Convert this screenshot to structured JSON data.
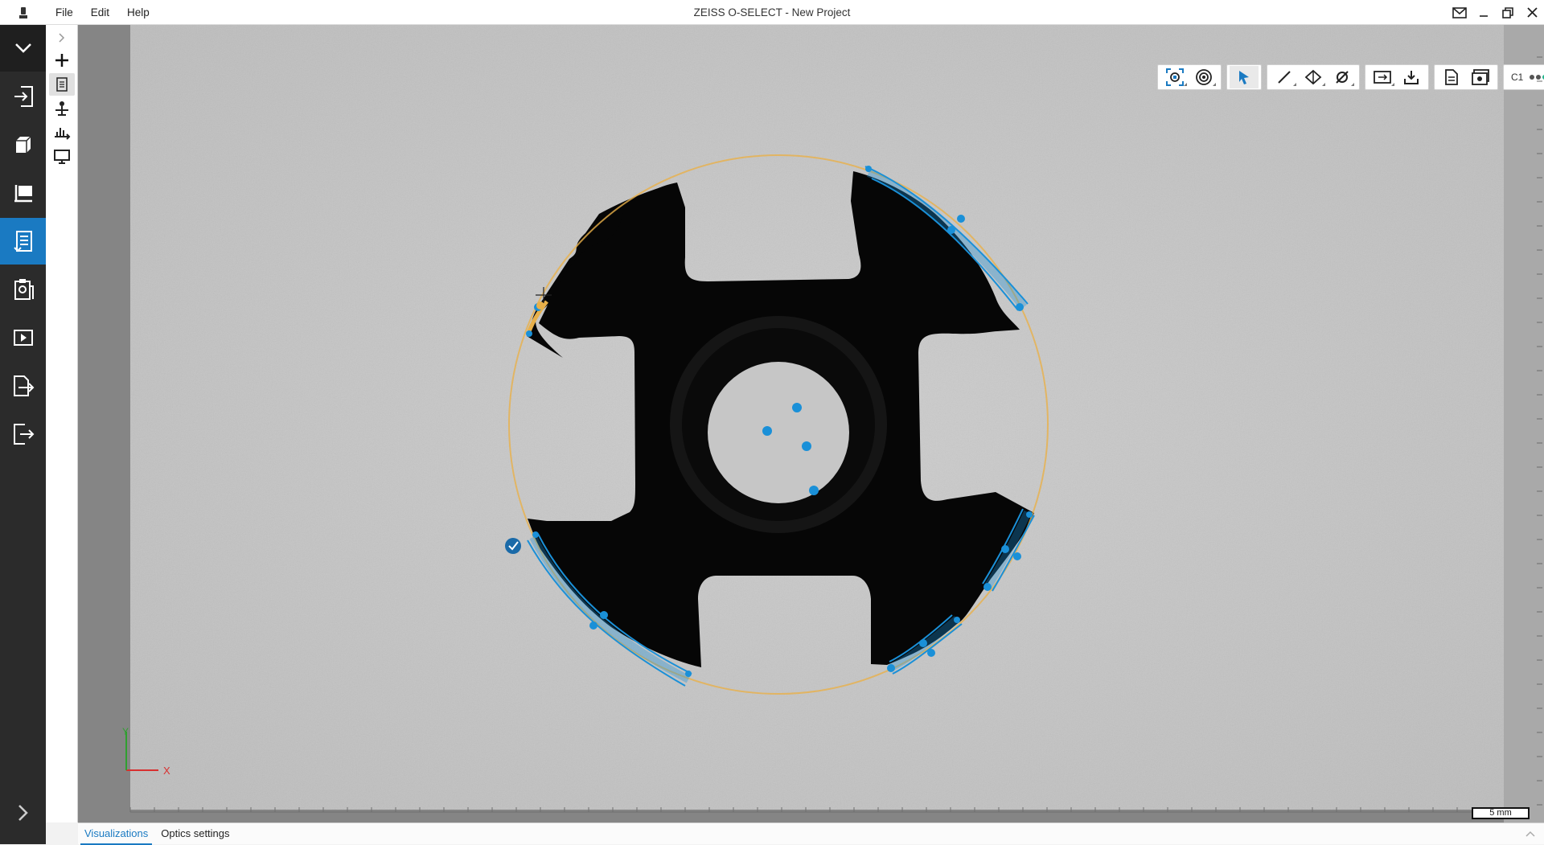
{
  "window": {
    "title": "ZEISS O-SELECT - New Project",
    "menu": [
      "File",
      "Edit",
      "Help"
    ]
  },
  "left_nav": {
    "items": [
      {
        "name": "collapse",
        "icon": "chevron-down-icon"
      },
      {
        "name": "import",
        "icon": "import-icon"
      },
      {
        "name": "part",
        "icon": "cube-icon"
      },
      {
        "name": "fixture",
        "icon": "fixture-icon"
      },
      {
        "name": "inspection-plan",
        "icon": "checklist-icon",
        "active": true
      },
      {
        "name": "report",
        "icon": "clipboard-icon"
      },
      {
        "name": "run",
        "icon": "play-icon"
      },
      {
        "name": "export-report",
        "icon": "document-export-icon"
      },
      {
        "name": "exit",
        "icon": "exit-icon"
      },
      {
        "name": "expand",
        "icon": "chevron-right-icon"
      }
    ]
  },
  "side_toolbar": {
    "items": [
      {
        "icon": "chevron-right-icon"
      },
      {
        "icon": "plus-icon"
      },
      {
        "icon": "document-icon",
        "selected": true
      },
      {
        "icon": "alignment-icon"
      },
      {
        "icon": "histogram-icon"
      },
      {
        "icon": "monitor-icon"
      }
    ]
  },
  "view_toolbar": {
    "c1_label": "C1",
    "groups": [
      [
        "fit-view-icon",
        "target-icon"
      ],
      [
        "pointer-icon"
      ],
      [
        "line-icon",
        "plane-icon",
        "diameter-icon"
      ],
      [
        "zoom-rect-icon",
        "download-icon"
      ],
      [
        "report-icon",
        "capture-icon"
      ]
    ]
  },
  "scale_bar": {
    "label": "5 mm"
  },
  "axes": {
    "x": "X",
    "y": "Y"
  },
  "bottom_tabs": [
    {
      "label": "Visualizations",
      "active": true
    },
    {
      "label": "Optics settings",
      "active": false
    }
  ],
  "colors": {
    "accent": "#1a7ac2",
    "measure_blue": "#1a90d8",
    "fit_orange": "#e8b04a",
    "part": "#080808",
    "background_gray": "#c9c9c9",
    "nav_dark": "#2b2b2b"
  }
}
